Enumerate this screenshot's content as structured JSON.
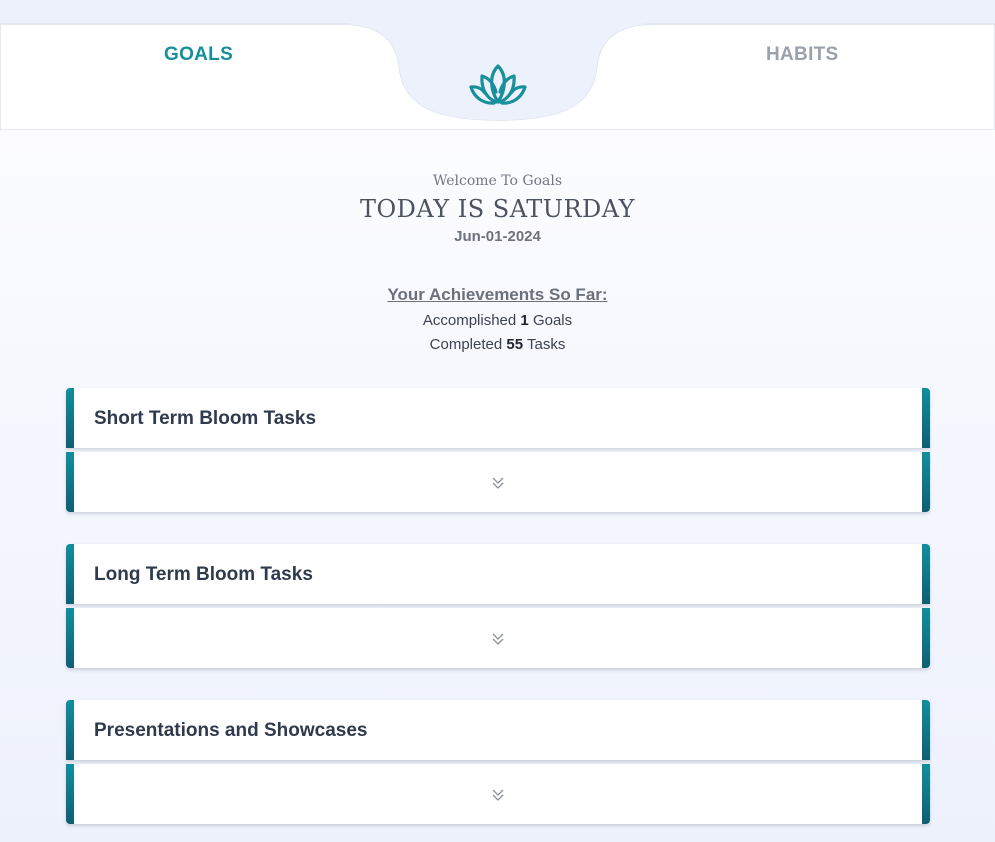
{
  "nav": {
    "tabs": [
      {
        "label": "GOALS",
        "active": true
      },
      {
        "label": "HABITS",
        "active": false
      }
    ],
    "logo_icon": "lotus-icon"
  },
  "header": {
    "welcome": "Welcome To Goals",
    "today": "TODAY IS SATURDAY",
    "date": "Jun-01-2024"
  },
  "achievements": {
    "title": "Your Achievements So Far:",
    "goals_prefix": "Accomplished",
    "goals_count": "1",
    "goals_suffix": "Goals",
    "tasks_prefix": "Completed",
    "tasks_count": "55",
    "tasks_suffix": "Tasks"
  },
  "sections": [
    {
      "title": "Short Term Bloom Tasks",
      "expand_icon": "double-chevron-down-icon"
    },
    {
      "title": "Long Term Bloom Tasks",
      "expand_icon": "double-chevron-down-icon"
    },
    {
      "title": "Presentations and Showcases",
      "expand_icon": "double-chevron-down-icon"
    }
  ],
  "colors": {
    "accent": "#17909c",
    "accent_dark": "#0f5f73",
    "inactive_tab": "#9aa1ad",
    "background": "#edf1fc"
  }
}
